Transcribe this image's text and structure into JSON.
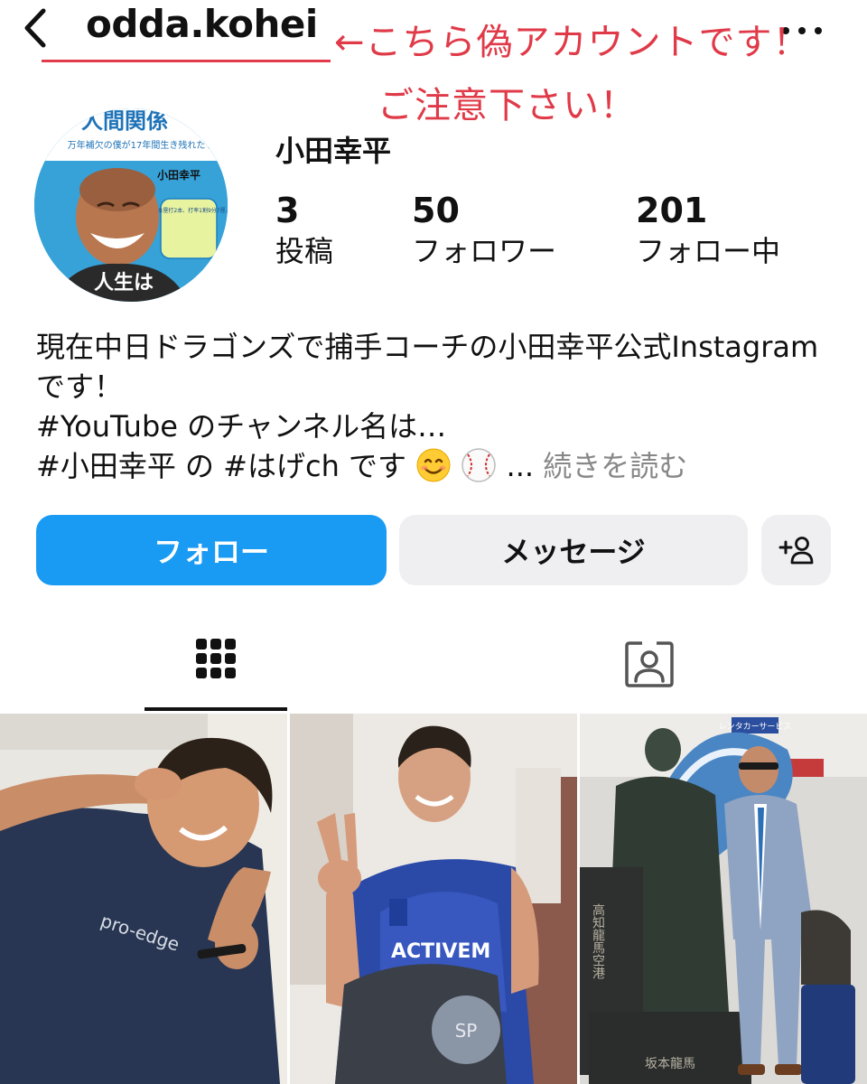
{
  "header": {
    "username": "odda.kohei",
    "annotation_line1": "←こちら偽アカウントです！",
    "annotation_line2": "ご注意下さい！"
  },
  "profile": {
    "display_name": "小田幸平",
    "stats": [
      {
        "value": "3",
        "label": "投稿"
      },
      {
        "value": "50",
        "label": "フォロワー"
      },
      {
        "value": "201",
        "label": "フォロー中"
      }
    ],
    "bio": {
      "line1": "現在中日ドラゴンズで捕手コーチの小田幸平公式Instagram",
      "line2": "です！",
      "line3": "#YouTube のチャンネル名は…",
      "line4": "#小田幸平 の #はげch です",
      "ellipsis": "...",
      "more": "続きを読む"
    },
    "avatar_image_text": {
      "headline": "人間関係",
      "subline": "万年補欠の僕が17年間生き残れたワ",
      "name": "小田幸平",
      "bubble": "通算本塁打2本、打率1割9分7厘。",
      "bottom": "人生は"
    }
  },
  "actions": {
    "follow_label": "フォロー",
    "message_label": "メッセージ"
  },
  "tabs": [
    {
      "name": "posts-grid",
      "icon": "grid-icon",
      "active": true
    },
    {
      "name": "tagged",
      "icon": "person-tag-icon",
      "active": false
    }
  ],
  "posts": {
    "photo1_shirt_text": "pro-edge",
    "photo2_shirt_text": "ACTIVEM",
    "photo3_statue_text": "高知龍馬空港",
    "photo3_base_text": "坂本龍馬",
    "photo3_sign_text": "レンタカーサービス"
  },
  "colors": {
    "accent": "#1a9bf3",
    "annotation": "#e03a48",
    "button_gray": "#efeff2"
  }
}
